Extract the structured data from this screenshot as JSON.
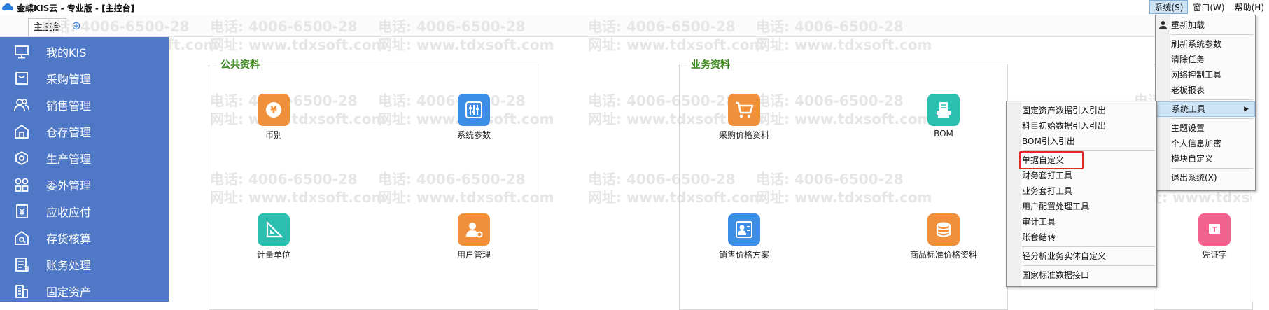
{
  "window": {
    "title": "金蝶KIS云 - 专业版 - [主控台]"
  },
  "menubar": [
    {
      "label": "系统(S)"
    },
    {
      "label": "窗口(W)"
    },
    {
      "label": "帮助(H)"
    }
  ],
  "tabs": {
    "main": "主控台",
    "add_icon": "plus-icon"
  },
  "sidebar": {
    "items": [
      {
        "label": "我的KIS",
        "icon": "monitor-icon"
      },
      {
        "label": "采购管理",
        "icon": "shopping-bag-icon"
      },
      {
        "label": "销售管理",
        "icon": "users-icon"
      },
      {
        "label": "仓存管理",
        "icon": "warehouse-icon"
      },
      {
        "label": "生产管理",
        "icon": "hexagon-gear-icon"
      },
      {
        "label": "委外管理",
        "icon": "outsource-icon"
      },
      {
        "label": "应收应付",
        "icon": "yen-document-icon"
      },
      {
        "label": "存货核算",
        "icon": "inventory-search-icon"
      },
      {
        "label": "账务处理",
        "icon": "ledger-icon"
      },
      {
        "label": "固定资产",
        "icon": "building-icon"
      }
    ]
  },
  "panels": {
    "public": {
      "title": "公共资料",
      "tiles": [
        {
          "label": "币别",
          "icon": "currency-icon",
          "color": "#f0903a"
        },
        {
          "label": "系统参数",
          "icon": "sliders-icon",
          "color": "#3d8ee6"
        },
        {
          "label": "计量单位",
          "icon": "ruler-icon",
          "color": "#2bbfb0"
        },
        {
          "label": "用户管理",
          "icon": "user-gear-icon",
          "color": "#f0903a"
        }
      ]
    },
    "business": {
      "title": "业务资料",
      "tiles": [
        {
          "label": "采购价格资料",
          "icon": "cart-icon",
          "color": "#f0903a"
        },
        {
          "label": "BOM",
          "icon": "bom-icon",
          "color": "#2bbfb0"
        },
        {
          "label": "销售价格方案",
          "icon": "price-user-icon",
          "color": "#3d8ee6"
        },
        {
          "label": "商品标准价格资料",
          "icon": "database-icon",
          "color": "#f0903a"
        }
      ]
    },
    "voucher_tile": {
      "label": "凭证字",
      "icon": "voucher-icon",
      "color": "#f2628f"
    }
  },
  "watermark": {
    "phone": "电话: 4006-6500-28",
    "site": "网址: www.tdxsoft.com"
  },
  "system_menu": {
    "items": [
      {
        "label": "重新加载",
        "icon": "reload-icon"
      },
      {
        "label": "刷新系统参数"
      },
      {
        "label": "清除任务"
      },
      {
        "label": "网络控制工具"
      },
      {
        "label": "老板报表"
      },
      {
        "label": "系统工具",
        "has_submenu": true
      },
      {
        "label": "主题设置"
      },
      {
        "label": "个人信息加密"
      },
      {
        "label": "模块自定义"
      },
      {
        "label": "退出系统(X)"
      }
    ]
  },
  "tools_submenu": {
    "items": [
      {
        "label": "固定资产数据引入引出"
      },
      {
        "label": "科目初始数据引入引出"
      },
      {
        "label": "BOM引入引出"
      },
      {
        "label": "单据自定义"
      },
      {
        "label": "财务套打工具"
      },
      {
        "label": "业务套打工具"
      },
      {
        "label": "用户配置处理工具"
      },
      {
        "label": "审计工具"
      },
      {
        "label": "账套结转"
      },
      {
        "label": "轻分析业务实体自定义"
      },
      {
        "label": "国家标准数据接口"
      }
    ]
  },
  "colors": {
    "sidebar": "#4f79c6",
    "panel_title": "#3d8a1f",
    "highlight_box": "#e12a2a"
  }
}
